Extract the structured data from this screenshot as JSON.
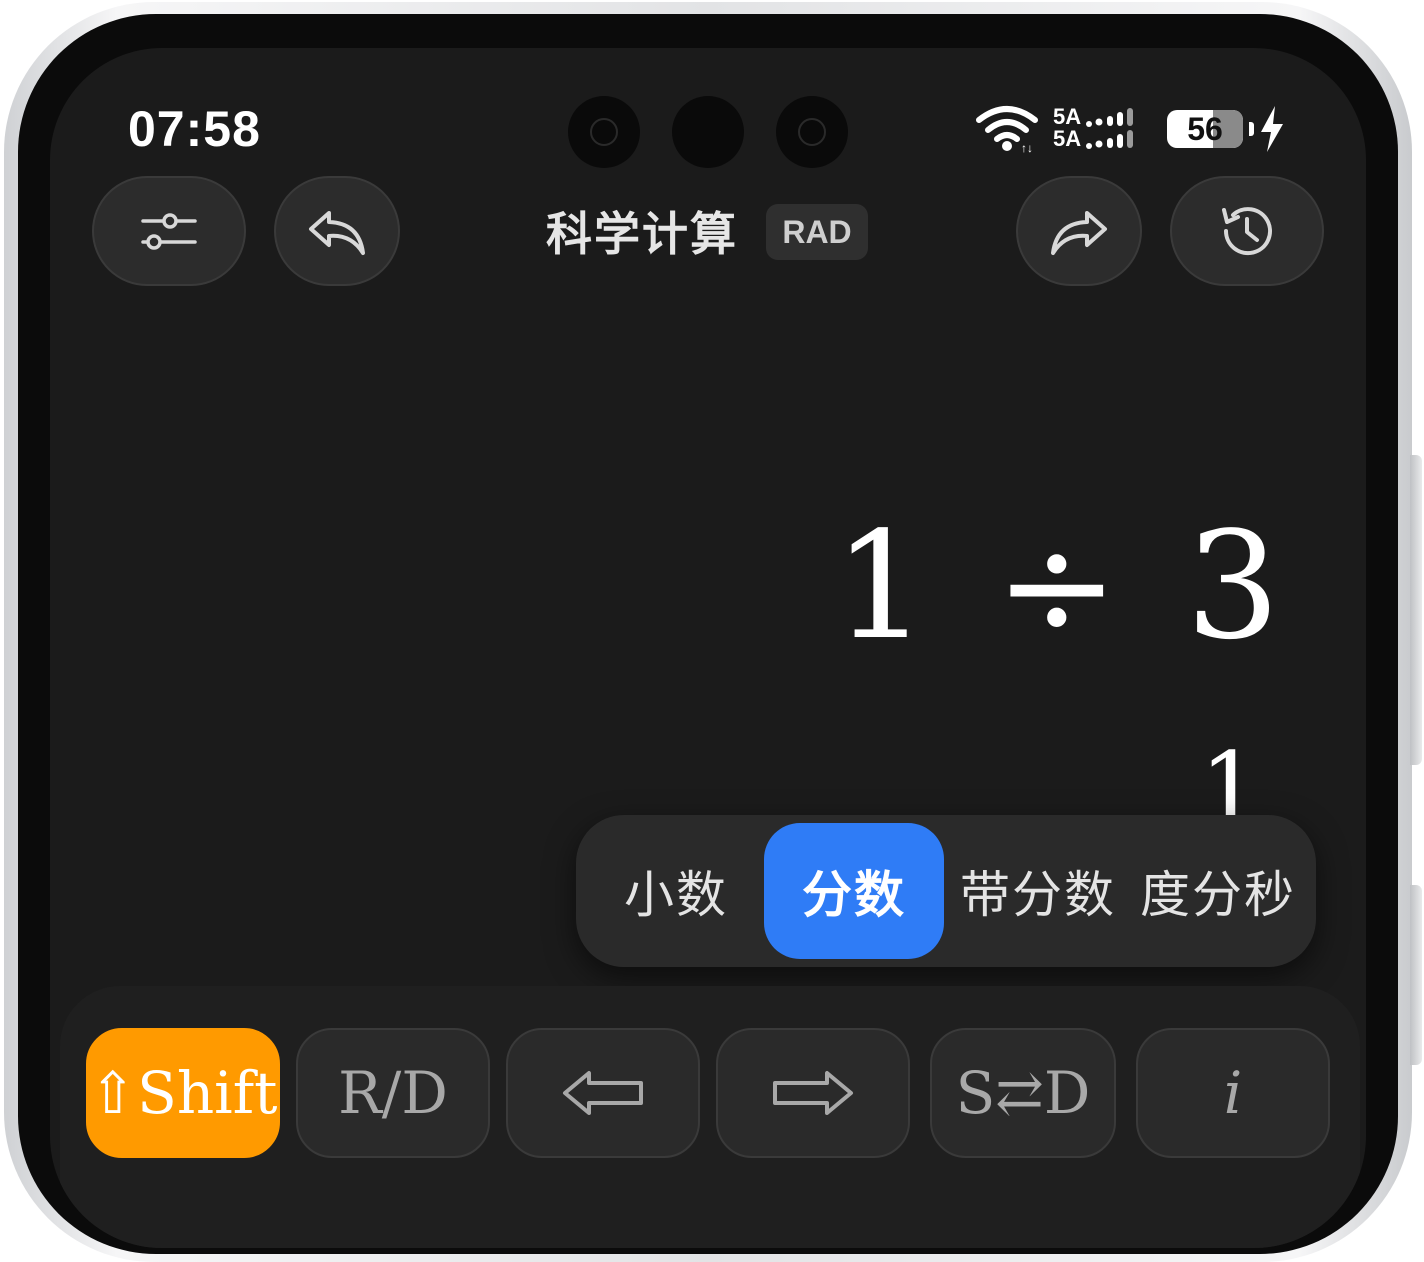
{
  "status_bar": {
    "time": "07:58",
    "network_1": "5A",
    "network_2": "5A",
    "battery": "56"
  },
  "toolbar": {
    "title": "科学计算",
    "angle_mode": "RAD"
  },
  "display": {
    "expression_left": "1",
    "operator": "÷",
    "expression_right": "3",
    "result_numerator": "1"
  },
  "format_options": [
    {
      "label": "小数",
      "selected": false
    },
    {
      "label": "分数",
      "selected": true
    },
    {
      "label": "带分数",
      "selected": false
    },
    {
      "label": "度分秒",
      "selected": false
    }
  ],
  "keys": {
    "shift": "⇧Shift",
    "rd": "R/D",
    "sd": "S⇄D",
    "imag": "i"
  },
  "colors": {
    "accent_blue": "#2f7cf6",
    "shift_orange": "#ff9a00",
    "background": "#1b1b1b"
  }
}
